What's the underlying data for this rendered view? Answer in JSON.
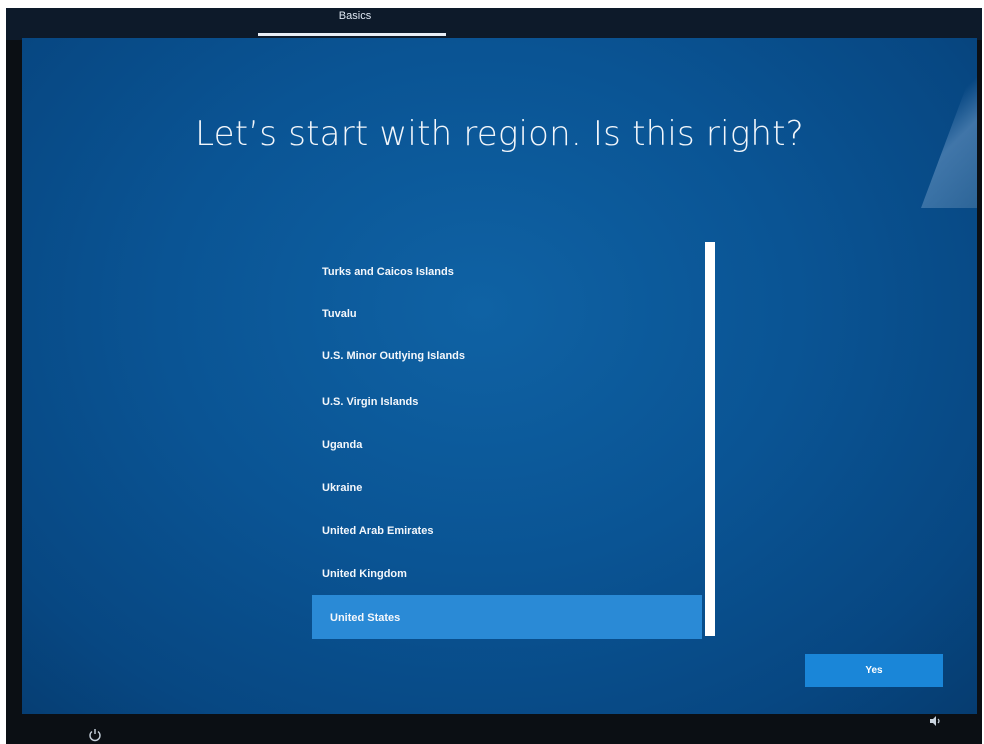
{
  "header": {
    "tab_label": "Basics"
  },
  "page": {
    "title": "Let’s start with region. Is this right?"
  },
  "region_list": {
    "items": [
      "Turks and Caicos Islands",
      "Tuvalu",
      "U.S. Minor Outlying Islands",
      "U.S. Virgin Islands",
      "Uganda",
      "Ukraine",
      "United Arab Emirates",
      "United Kingdom",
      "United States"
    ],
    "selected": "United States"
  },
  "actions": {
    "yes_label": "Yes"
  },
  "footer": {
    "left_icon": "power-icon",
    "right_icon": "volume-icon"
  },
  "colors": {
    "background": "#0a5494",
    "selected": "#2a8ad6",
    "button": "#1a86d8"
  }
}
